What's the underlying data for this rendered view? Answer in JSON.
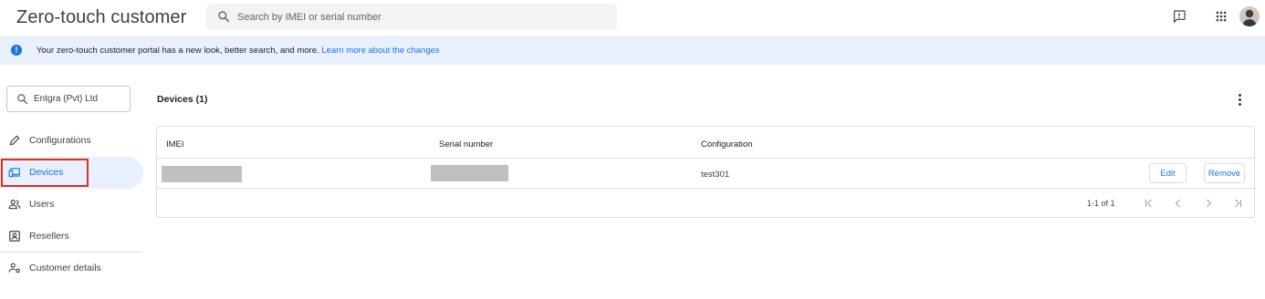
{
  "header": {
    "title": "Zero-touch customer",
    "search_placeholder": "Search by IMEI or serial number",
    "icons": [
      "feedback-icon",
      "apps-grid-icon",
      "avatar"
    ]
  },
  "banner": {
    "message": "Your zero-touch customer portal has a new look, better search, and more. ",
    "link_text": "Learn more about the changes",
    "icon": "info-icon"
  },
  "sidebar": {
    "org_label": "Entgra (Pvt) Ltd",
    "items": [
      {
        "label": "Configurations",
        "icon": "pencil-icon"
      },
      {
        "label": "Devices",
        "icon": "devices-icon",
        "active": true
      },
      {
        "label": "Users",
        "icon": "users-icon"
      },
      {
        "label": "Resellers",
        "icon": "reseller-badge-icon"
      },
      {
        "label": "Customer details",
        "icon": "customer-details-icon"
      }
    ]
  },
  "main": {
    "title": "Devices (1)",
    "table": {
      "columns": [
        "IMEI",
        "Serial number",
        "Configuration"
      ],
      "rows": [
        {
          "imei": "",
          "serial": "",
          "configuration": "test301",
          "edit_label": "Edit",
          "remove_label": "Remove"
        }
      ]
    },
    "pagination": {
      "range": "1-1 of 1"
    }
  },
  "colors": {
    "accent": "#1a73e8",
    "banner_bg": "#e8f0fe",
    "highlight": "#d93025",
    "redaction": "#c0c0c0"
  }
}
